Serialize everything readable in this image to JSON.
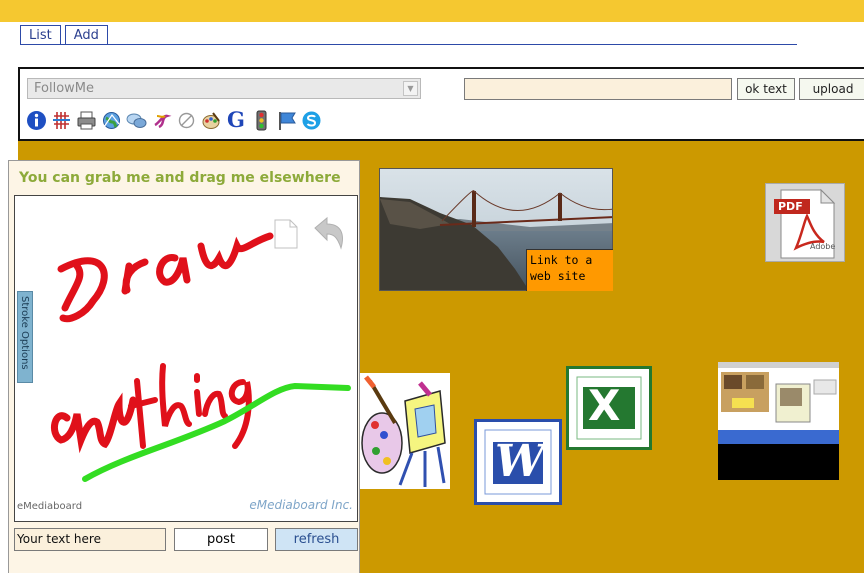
{
  "tabs": [
    {
      "label": "List"
    },
    {
      "label": "Add"
    }
  ],
  "toolbar": {
    "select_value": "FollowMe",
    "text_input_value": "",
    "ok_text_label": "ok text",
    "upload_label": "upload",
    "icons": [
      "info-icon",
      "grid-icon",
      "printer-icon",
      "globe-icon",
      "chat-icon",
      "swirl-icon",
      "no-entry-icon",
      "palette-icon",
      "google-g-icon",
      "traffic-light-icon",
      "flag-icon",
      "skype-icon"
    ],
    "google_letter": "G"
  },
  "draw_panel": {
    "title": "You can grab me and drag me elsewhere",
    "stroke_options_label": "Stroke Options",
    "footer_left": "eMediaboard",
    "footer_right": "eMediaboard Inc.",
    "post_input_value": "Your text here",
    "post_label": "post",
    "refresh_label": "refresh"
  },
  "board": {
    "link_label": "Link to a web site",
    "pdf_label": "PDF",
    "adobe_label": "Adobe",
    "word_letter": "W",
    "excel_letter": "X"
  },
  "colors": {
    "top_bar": "#f5c830",
    "board_bg": "#cc9900",
    "link_bg": "#ff9900",
    "title_green": "#8daa3a"
  }
}
